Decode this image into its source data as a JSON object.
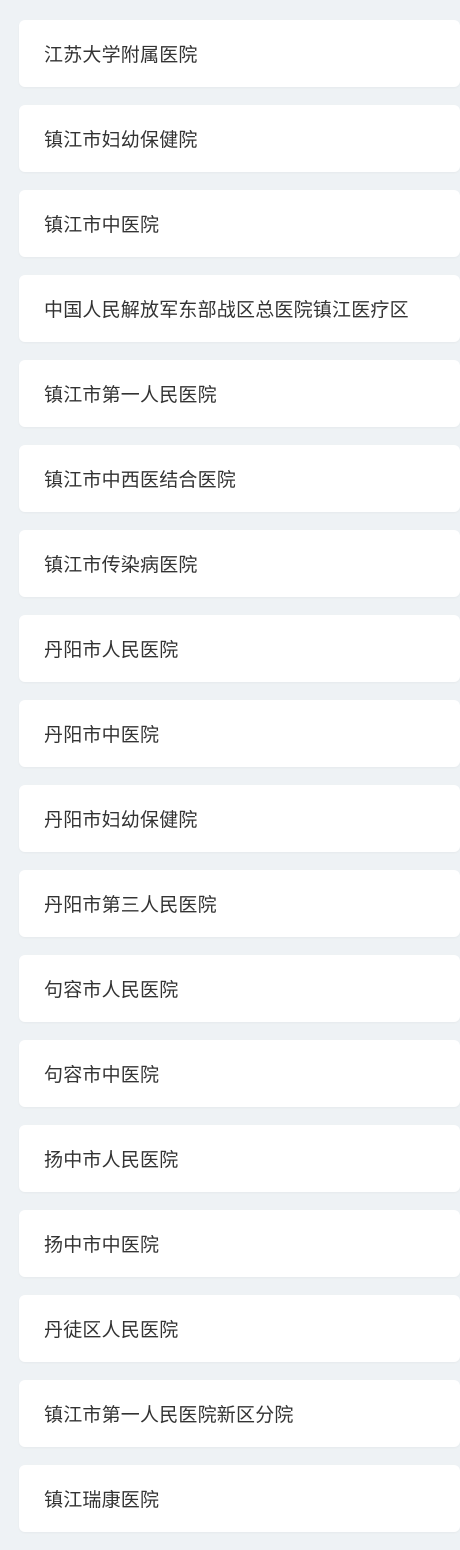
{
  "hospitals": [
    "江苏大学附属医院",
    "镇江市妇幼保健院",
    "镇江市中医院",
    "中国人民解放军东部战区总医院镇江医疗区",
    "镇江市第一人民医院",
    "镇江市中西医结合医院",
    "镇江市传染病医院",
    "丹阳市人民医院",
    "丹阳市中医院",
    "丹阳市妇幼保健院",
    "丹阳市第三人民医院",
    "句容市人民医院",
    "句容市中医院",
    "扬中市人民医院",
    "扬中市中医院",
    "丹徒区人民医院",
    "镇江市第一人民医院新区分院",
    "镇江瑞康医院"
  ]
}
